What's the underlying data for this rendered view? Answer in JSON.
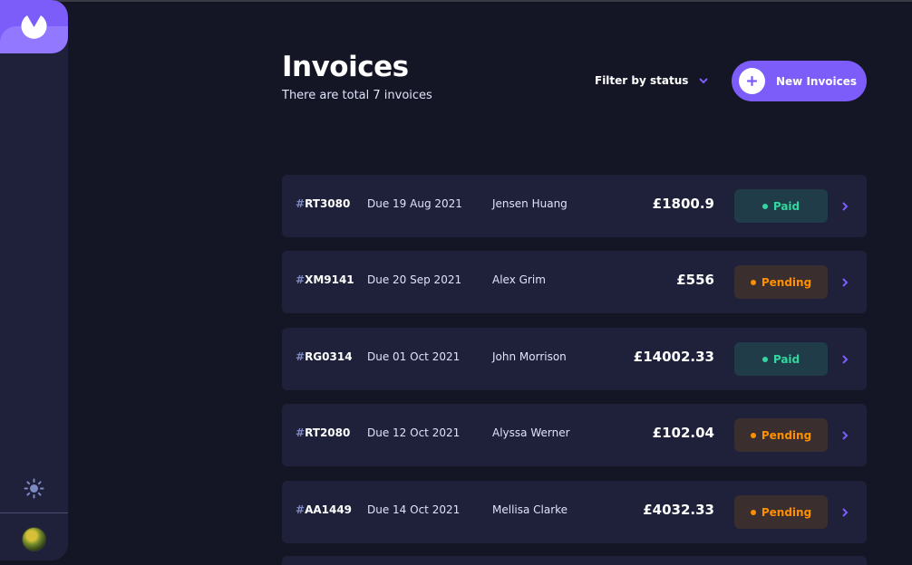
{
  "header": {
    "title": "Invoices",
    "subtitle": "There are total 7 invoices",
    "filter_label": "Filter by status",
    "new_button_label": "New Invoices"
  },
  "sidebar": {
    "logo_icon": "logo-icon",
    "theme_icon": "sun-icon",
    "avatar": "user-avatar"
  },
  "invoices": [
    {
      "hash": "#",
      "id": "RT3080",
      "due": "Due 19 Aug 2021",
      "client": "Jensen Huang",
      "amount": "£1800.9",
      "status": "Paid"
    },
    {
      "hash": "#",
      "id": "XM9141",
      "due": "Due 20 Sep 2021",
      "client": "Alex Grim",
      "amount": "£556",
      "status": "Pending"
    },
    {
      "hash": "#",
      "id": "RG0314",
      "due": "Due 01 Oct 2021",
      "client": "John Morrison",
      "amount": "£14002.33",
      "status": "Paid"
    },
    {
      "hash": "#",
      "id": "RT2080",
      "due": "Due 12 Oct 2021",
      "client": "Alyssa Werner",
      "amount": "£102.04",
      "status": "Pending"
    },
    {
      "hash": "#",
      "id": "AA1449",
      "due": "Due 14 Oct 2021",
      "client": "Mellisa Clarke",
      "amount": "£4032.33",
      "status": "Pending"
    }
  ],
  "colors": {
    "accent": "#7c5dfa",
    "background": "#141625",
    "card": "#1e2139",
    "paid": "#33d69f",
    "pending": "#ff8f00"
  }
}
